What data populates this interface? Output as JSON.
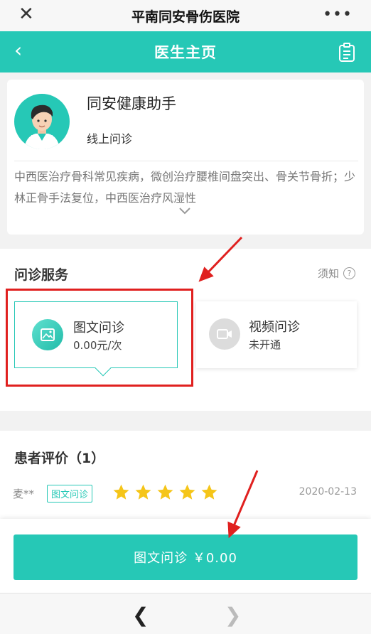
{
  "topbar": {
    "title": "平南同安骨伤医院",
    "close_icon": "close-icon",
    "more_icon": "more-icon"
  },
  "navbar": {
    "title": "医生主页",
    "back_icon": "chevron-left-icon",
    "doc_icon": "document-list-icon"
  },
  "doctor": {
    "name": "同安健康助手",
    "tag": "线上问诊",
    "intro": "中西医治疗骨科常见疾病，微创治疗腰椎间盘突出、骨关节骨折；少林正骨手法复位，中西医治疗风湿性"
  },
  "services": {
    "title": "问诊服务",
    "notice": "须知",
    "items": [
      {
        "name": "图文问诊",
        "sub": "0.00元/次"
      },
      {
        "name": "视频问诊",
        "sub": "未开通"
      }
    ]
  },
  "reviews": {
    "title": "患者评价（1）",
    "items": [
      {
        "user": "麦**",
        "tag": "图文问诊",
        "stars": 5,
        "date": "2020-02-13"
      }
    ]
  },
  "action": {
    "button_label": "图文问诊 ￥0.00"
  },
  "colors": {
    "accent": "#26c8b6",
    "annotation": "#e0201f",
    "star": "#f5c518"
  }
}
